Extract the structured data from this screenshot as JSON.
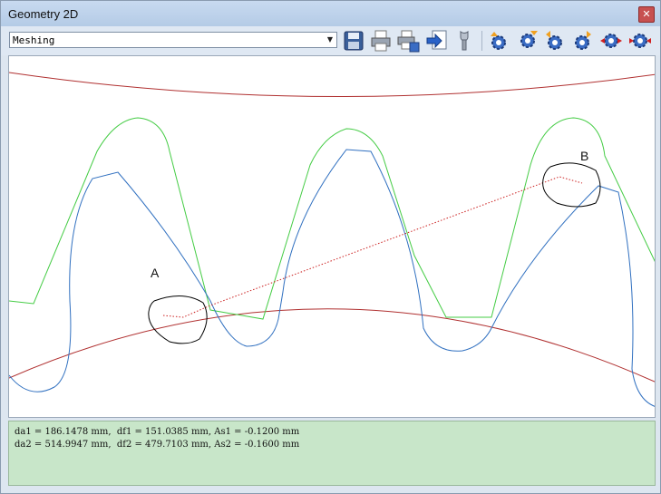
{
  "window": {
    "title": "Geometry 2D",
    "close_glyph": "✕"
  },
  "toolbar": {
    "mode_select": {
      "selected": "Meshing"
    },
    "buttons": [
      {
        "name": "save-icon"
      },
      {
        "name": "print-icon"
      },
      {
        "name": "print-settings-icon"
      },
      {
        "name": "export-icon"
      },
      {
        "name": "tool-icon"
      },
      {
        "name": "gear-up-icon"
      },
      {
        "name": "gear-down-icon"
      },
      {
        "name": "gear-left-icon"
      },
      {
        "name": "gear-right-icon"
      },
      {
        "name": "gear-zoom-in-icon"
      },
      {
        "name": "gear-zoom-out-icon"
      }
    ]
  },
  "drawing": {
    "annotation_a": "A",
    "annotation_b": "B",
    "colors": {
      "circle": "#b03030",
      "gear1_profile": "#3070c0",
      "gear2_profile": "#44cc44",
      "contact_line": "#cc2222",
      "markup": "#000000"
    }
  },
  "info": {
    "line1": "da1 = 186.1478 mm,  df1 = 151.0385 mm, As1 = -0.1200 mm",
    "line2": "da2 = 514.9947 mm,  df2 = 479.7103 mm, As2 = -0.1600 mm"
  }
}
